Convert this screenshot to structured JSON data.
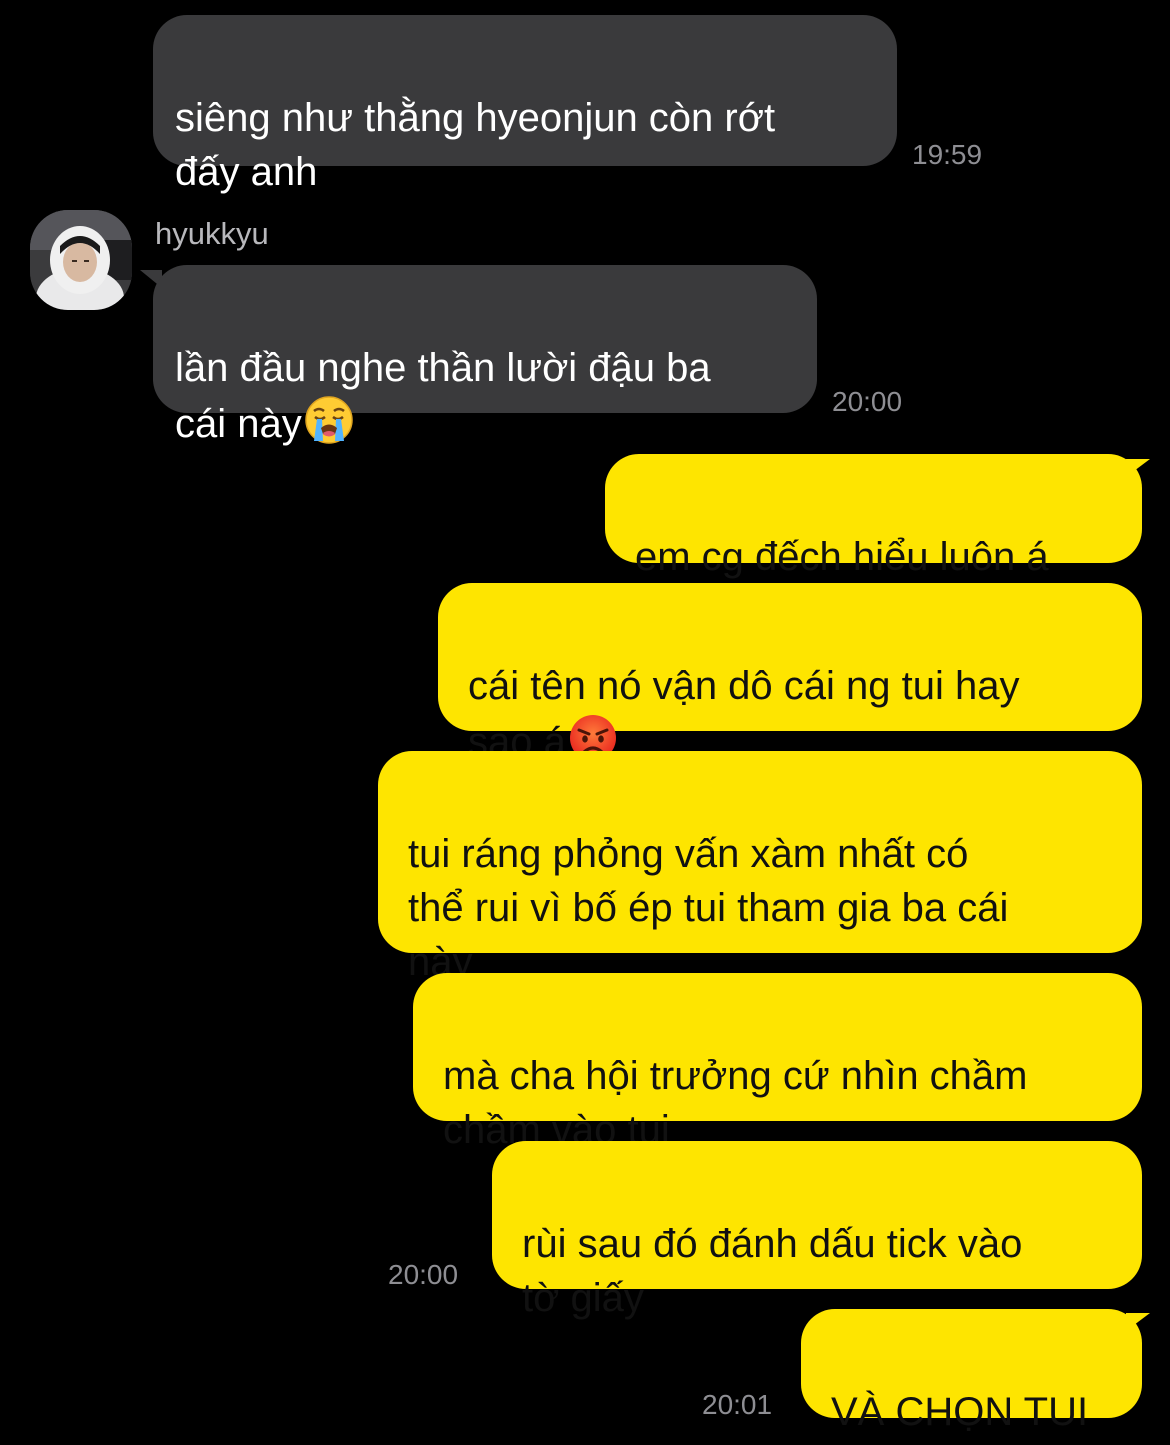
{
  "messages": {
    "m1": {
      "text": "siêng như thằng hyeonjun còn rớt\nđấy anh",
      "time": "19:59"
    },
    "m2": {
      "sender": "hyukkyu",
      "text": "lần đầu nghe thần lười đậu ba\ncái này",
      "emoji": "loudly-crying-face-icon",
      "time": "20:00"
    },
    "m3": {
      "text": "em cg đếch hiểu luôn á"
    },
    "m4": {
      "text": "cái tên nó vận dô cái ng tui hay\nsao á",
      "emoji": "angry-face-icon"
    },
    "m5": {
      "text": "tui ráng phỏng vấn xàm nhất có\nthể rui vì bố ép tui tham gia ba cái\nnày"
    },
    "m6": {
      "text": "mà cha hội trưởng cứ nhìn chầm\nchầm vào tui"
    },
    "m7": {
      "text": "rùi sau đó đánh dấu tick vào\ntờ giấy",
      "time": "20:00"
    },
    "m8": {
      "text": "VÀ CHỌN TUI",
      "time": "20:01"
    }
  },
  "colors": {
    "background": "#000000",
    "incoming_bubble": "#3a3a3c",
    "outgoing_bubble": "#fee500",
    "timestamp": "#8e8e93"
  }
}
